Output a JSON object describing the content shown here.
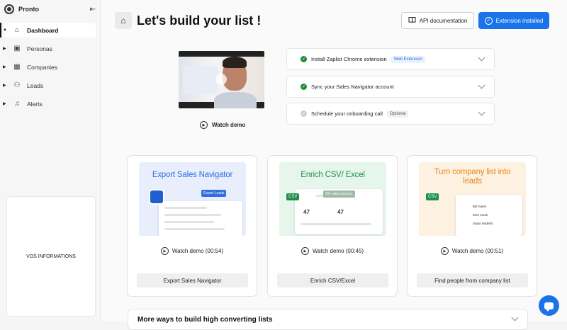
{
  "app": {
    "name": "Pronto"
  },
  "sidebar": {
    "items": [
      {
        "label": "Dashboard",
        "icon": "home-icon",
        "active": true
      },
      {
        "label": "Personas",
        "icon": "id-card-icon"
      },
      {
        "label": "Companies",
        "icon": "building-icon"
      },
      {
        "label": "Leads",
        "icon": "people-icon"
      },
      {
        "label": "Alerts",
        "icon": "bell-icon"
      }
    ],
    "info_box": "VOS INFORMATIONS"
  },
  "header": {
    "title": "Let's build your list !",
    "api_button": "API documentation",
    "extension_button": "Extension installed"
  },
  "demo": {
    "watch_label": "Watch demo"
  },
  "steps": [
    {
      "label": "Install Zaplist Chrome extension",
      "tag": "Web Extension",
      "done": true
    },
    {
      "label": "Sync your Sales Navigator account",
      "tag": "",
      "done": true
    },
    {
      "label": "Schedule your onboarding call",
      "tag": "Optional",
      "done": false
    }
  ],
  "cards": [
    {
      "thumb_title": "Export Sales Navigator",
      "thumb_badge": "Export Leads",
      "watch": "Watch demo (00:54)",
      "button": "Export Sales Navigator",
      "color": "#2f6fe0",
      "bg": "#e9eefc"
    },
    {
      "thumb_title": "Enrich CSV/ Excel",
      "thumb_badge": "20+ data sources",
      "thumb_badge2": "CSV",
      "thumb_stat": "47",
      "watch": "Watch demo (00:45)",
      "button": "Enrich CSV/Excel",
      "color": "#1f8f4c",
      "bg": "#e6f6ec"
    },
    {
      "thumb_title": "Turn company list into leads",
      "thumb_badge": "CSV",
      "thumb_rows": [
        "Bill Gates",
        "Elon musk",
        "Satya Nadella"
      ],
      "watch": "Watch demo (00:51)",
      "button": "Find people from company list",
      "color": "#e8871e",
      "bg": "#fdf1e2"
    }
  ],
  "more": {
    "title": "More ways to build high converting lists"
  }
}
